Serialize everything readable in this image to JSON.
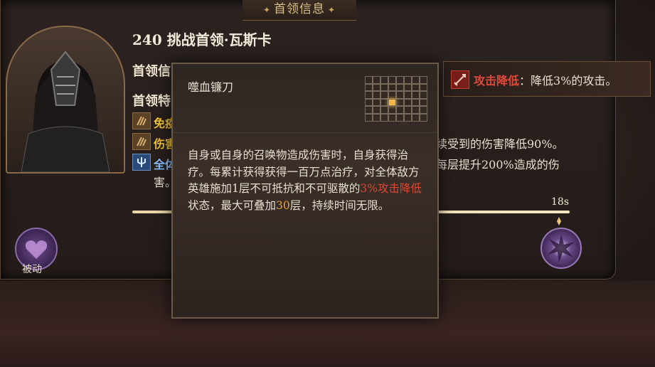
{
  "panel": {
    "title": "首领信息"
  },
  "boss": {
    "title": "240 挑战首领·瓦斯卡"
  },
  "sections": {
    "info": "首领信",
    "traits": "首领特"
  },
  "traits": [
    {
      "label": "免疫",
      "icon": "claw-icon"
    },
    {
      "label": "伤害",
      "icon": "claw-icon"
    },
    {
      "label": "全体",
      "icon": "trident-icon"
    }
  ],
  "right_text": {
    "line1": "续受到的伤害降低90%。",
    "line2": "每层提升200%造成的伤",
    "line3": "害。"
  },
  "timeline": {
    "time": "18s",
    "fill_fraction": 1.0
  },
  "passive": {
    "label": "被动"
  },
  "buff": {
    "name": "攻击降低",
    "desc": "：降低3%的攻击。"
  },
  "tooltip": {
    "name": "噬血镰刀",
    "desc_1": "自身或自身的召唤物造成伤害时，自身获得治疗。每累计获得获得一百万点治疗，对全体敌方英雄施加1层不可抵抗和不可驱散的",
    "desc_highlight": "3%攻击降低",
    "desc_2": "状态，最大可叠加",
    "desc_stack": "30",
    "desc_3": "层，持续时间无限。"
  },
  "colors": {
    "accent_gold": "#f1c232",
    "debuff_red": "#e04a3a",
    "stack_orange": "#e8a03a"
  }
}
